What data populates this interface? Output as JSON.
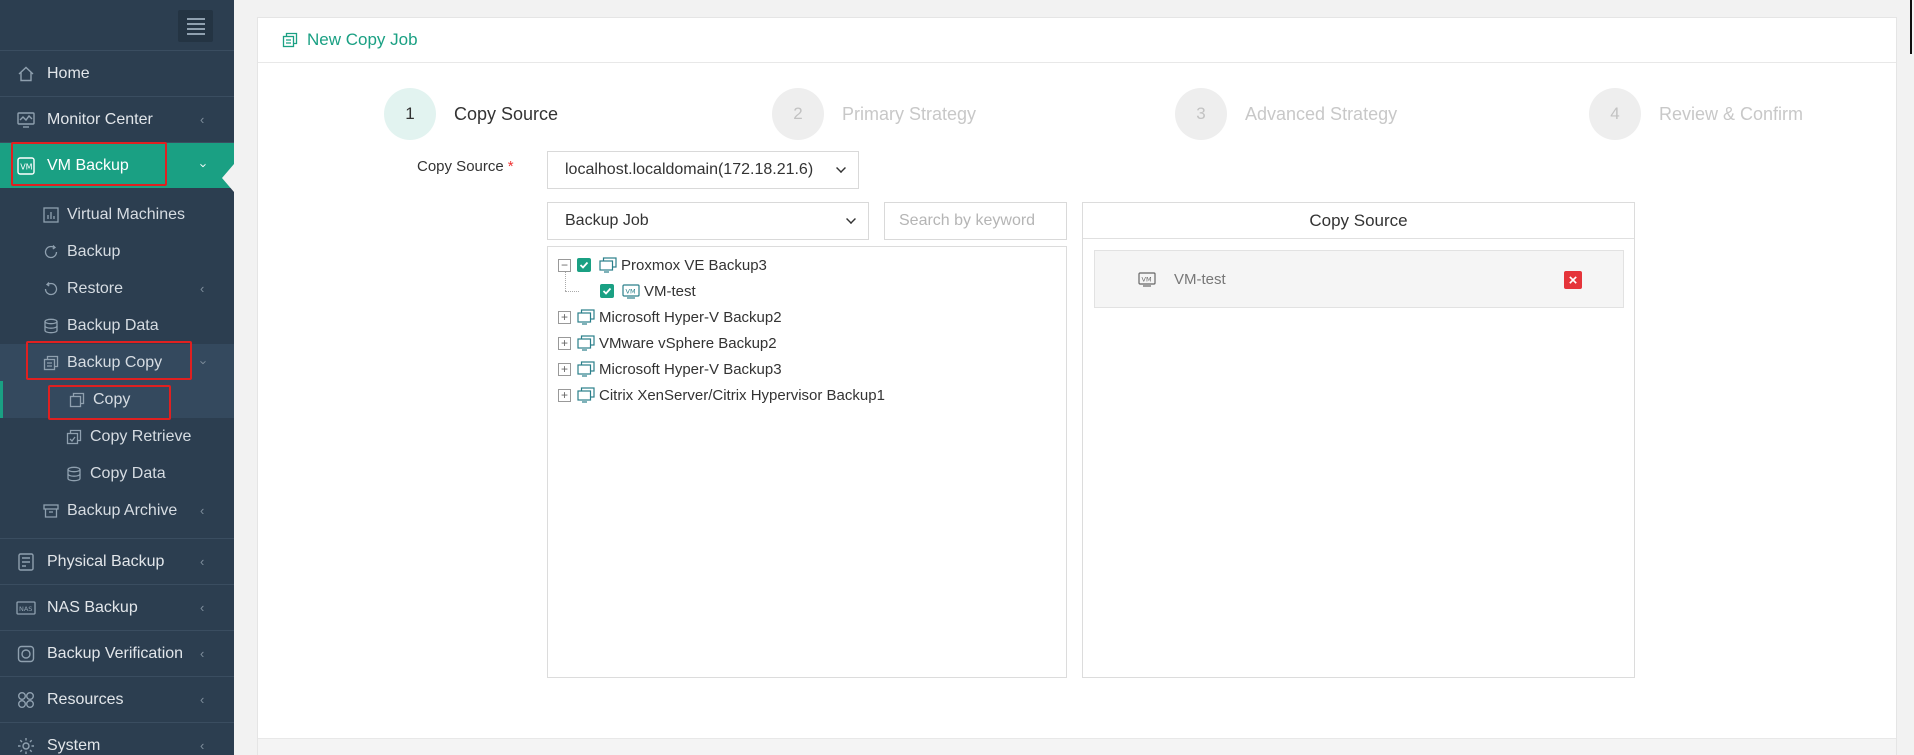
{
  "sidebar": {
    "items": [
      {
        "label": "Home",
        "icon": "home-icon"
      },
      {
        "label": "Monitor Center",
        "icon": "monitor-icon"
      },
      {
        "label": "VM Backup",
        "icon": "vm-icon"
      },
      {
        "label": "Virtual Machines",
        "icon": "chart-icon"
      },
      {
        "label": "Backup",
        "icon": "backup-icon"
      },
      {
        "label": "Restore",
        "icon": "restore-icon"
      },
      {
        "label": "Backup Data",
        "icon": "database-icon"
      },
      {
        "label": "Backup Copy",
        "icon": "copy-icon"
      },
      {
        "label": "Copy",
        "icon": "copy-icon"
      },
      {
        "label": "Copy Retrieve",
        "icon": "copy-retrieve-icon"
      },
      {
        "label": "Copy Data",
        "icon": "database-icon"
      },
      {
        "label": "Backup Archive",
        "icon": "archive-icon"
      },
      {
        "label": "Physical Backup",
        "icon": "server-icon"
      },
      {
        "label": "NAS Backup",
        "icon": "nas-icon"
      },
      {
        "label": "Backup Verification",
        "icon": "verify-icon"
      },
      {
        "label": "Resources",
        "icon": "resources-icon"
      },
      {
        "label": "System",
        "icon": "gear-icon"
      }
    ]
  },
  "page": {
    "title": "New Copy Job"
  },
  "steps": [
    {
      "num": "1",
      "label": "Copy Source"
    },
    {
      "num": "2",
      "label": "Primary Strategy"
    },
    {
      "num": "3",
      "label": "Advanced Strategy"
    },
    {
      "num": "4",
      "label": "Review & Confirm"
    }
  ],
  "form": {
    "copy_source_label": "Copy Source",
    "required_mark": "*",
    "host_select": "localhost.localdomain(172.18.21.6)",
    "type_select": "Backup Job",
    "search_placeholder": "Search by keyword"
  },
  "tree": {
    "nodes": [
      {
        "label": "Proxmox VE Backup3",
        "expanded": true,
        "checked": true
      },
      {
        "label": "VM-test",
        "checked": true
      },
      {
        "label": "Microsoft Hyper-V Backup2",
        "expanded": false
      },
      {
        "label": "VMware vSphere Backup2",
        "expanded": false
      },
      {
        "label": "Microsoft Hyper-V Backup3",
        "expanded": false
      },
      {
        "label": "Citrix XenServer/Citrix Hypervisor Backup1",
        "expanded": false
      }
    ]
  },
  "selected_panel": {
    "title": "Copy Source",
    "items": [
      {
        "label": "VM-test"
      }
    ]
  },
  "colors": {
    "accent": "#1aa083",
    "sidebar": "#2c3e50",
    "highlight": "#e02020",
    "remove": "#e5343a"
  }
}
